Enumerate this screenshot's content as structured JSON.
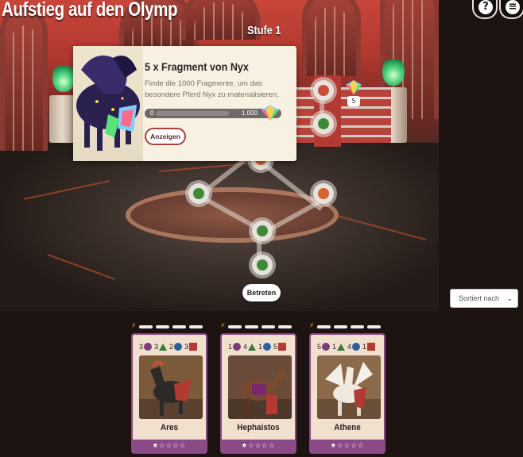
{
  "game": {
    "title": "Aufstieg auf den Olymp",
    "level": "Stufe 1"
  },
  "map": {
    "enter_button": "Betreten",
    "gem_reward_count": "5"
  },
  "popup": {
    "title": "5 x Fragment von Nyx",
    "description": "Finde die 1000 Fragmente, um das besondere Pferd Nyx zu materialisieren.",
    "progress_min": "0",
    "progress_max": "1.000",
    "progress_value": 0,
    "show_button": "Anzeigen"
  },
  "top_buttons": {
    "help_icon": "question-icon",
    "list_icon": "list-icon"
  },
  "sort": {
    "label": "Sortiert nach"
  },
  "horses": [
    {
      "name": "Ares",
      "stats": [
        "3",
        "3",
        "2",
        "3"
      ],
      "energy_segments": 4,
      "stars": "★☆☆☆☆"
    },
    {
      "name": "Hephaistos",
      "stats": [
        "1",
        "4",
        "1",
        "5"
      ],
      "energy_segments": 4,
      "stars": "★☆☆☆☆"
    },
    {
      "name": "Athene",
      "stats": [
        "5",
        "1",
        "4",
        "1"
      ],
      "energy_segments": 4,
      "stars": "★☆☆☆☆"
    }
  ],
  "colors": {
    "accent_purple": "#8a4a86",
    "card_bg": "#f1e0cd",
    "energy": "#f2c21a",
    "node_green": "#3f8a36"
  }
}
